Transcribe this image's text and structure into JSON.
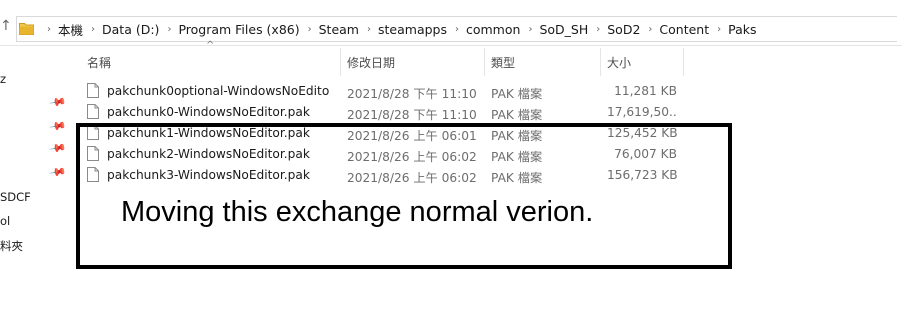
{
  "address_bar": {
    "path": [
      "本機",
      "Data (D:)",
      "Program Files (x86)",
      "Steam",
      "steamapps",
      "common",
      "SoD_SH",
      "SoD2",
      "Content",
      "Paks"
    ]
  },
  "left_pane": {
    "items": [
      "SDCF",
      "ol",
      "料夾"
    ]
  },
  "columns": {
    "name": "名稱",
    "modified": "修改日期",
    "type": "類型",
    "size": "大小"
  },
  "files": [
    {
      "name": "pakchunk0optional-WindowsNoEdito...",
      "modified": "2021/8/28 下午 11:10",
      "type": "PAK 檔案",
      "size": "11,281 KB"
    },
    {
      "name": "pakchunk0-WindowsNoEditor.pak",
      "modified": "2021/8/28 下午 11:10",
      "type": "PAK 檔案",
      "size": "17,619,50..."
    },
    {
      "name": "pakchunk1-WindowsNoEditor.pak",
      "modified": "2021/8/26 上午 06:01",
      "type": "PAK 檔案",
      "size": "125,452 KB"
    },
    {
      "name": "pakchunk2-WindowsNoEditor.pak",
      "modified": "2021/8/26 上午 06:02",
      "type": "PAK 檔案",
      "size": "76,007 KB"
    },
    {
      "name": "pakchunk3-WindowsNoEditor.pak",
      "modified": "2021/8/26 上午 06:02",
      "type": "PAK 檔案",
      "size": "156,723 KB"
    }
  ],
  "annotation": {
    "text": "Moving this exchange normal verion."
  },
  "colors": {
    "folder": "#e8b52f",
    "annotation_border": "#000000"
  }
}
